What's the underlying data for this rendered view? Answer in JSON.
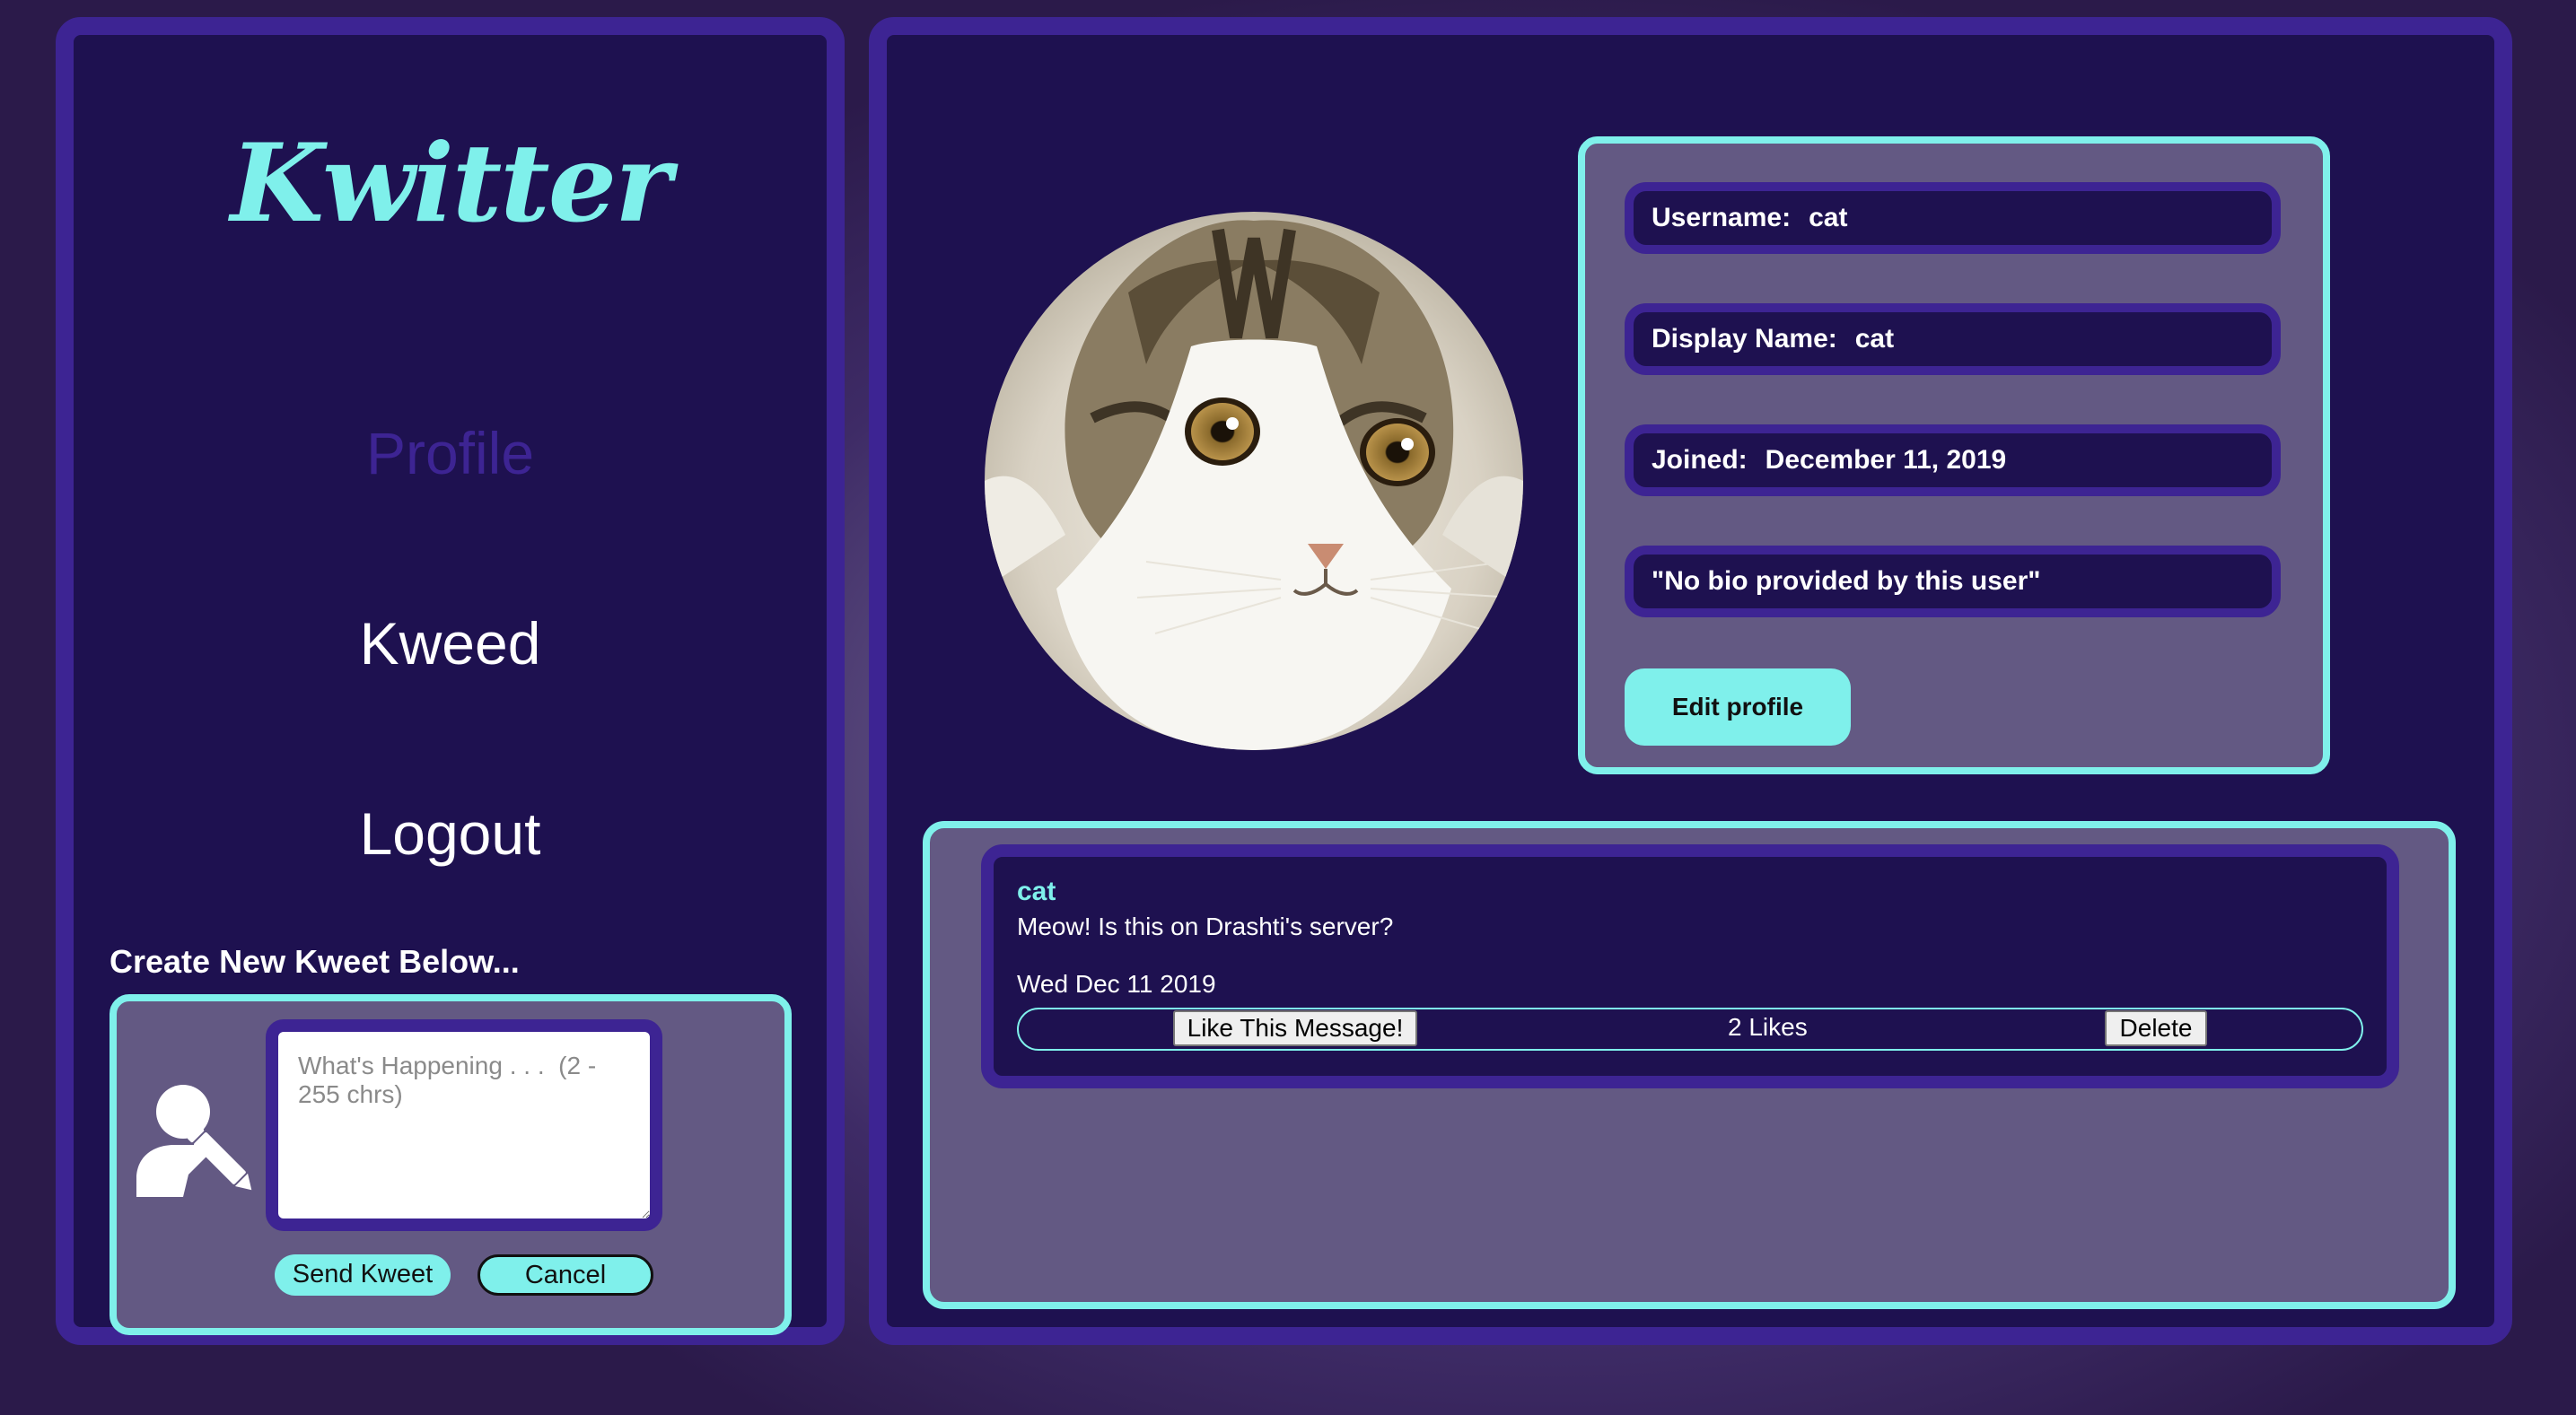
{
  "app": {
    "logo_text": "Kwitter"
  },
  "nav": {
    "profile_label": "Profile",
    "kweed_label": "Kweed",
    "logout_label": "Logout"
  },
  "compose": {
    "heading": "Create New Kweet Below...",
    "placeholder": "What's Happening . . .  (2 - 255 chrs)",
    "value": "",
    "send_label": "Send Kweet",
    "cancel_label": "Cancel",
    "avatar_icon": "user-edit-icon"
  },
  "profile": {
    "photo_alt": "cat",
    "username_label": "Username:",
    "username": "cat",
    "display_name_label": "Display Name:",
    "display_name": "cat",
    "joined_label": "Joined:",
    "joined": "December 11, 2019",
    "bio": "\"No bio provided by this user\"",
    "edit_label": "Edit profile"
  },
  "feed": {
    "kweets": [
      {
        "author": "cat",
        "text": "Meow! Is this on Drashti's server?",
        "date": "Wed Dec 11 2019",
        "like_label": "Like This Message!",
        "likes": "2 Likes",
        "delete_label": "Delete"
      }
    ]
  },
  "colors": {
    "accent": "#7ff0eb",
    "panel_bg": "#1e1150",
    "panel_border": "#3d2493",
    "card_bg": "#635983"
  }
}
